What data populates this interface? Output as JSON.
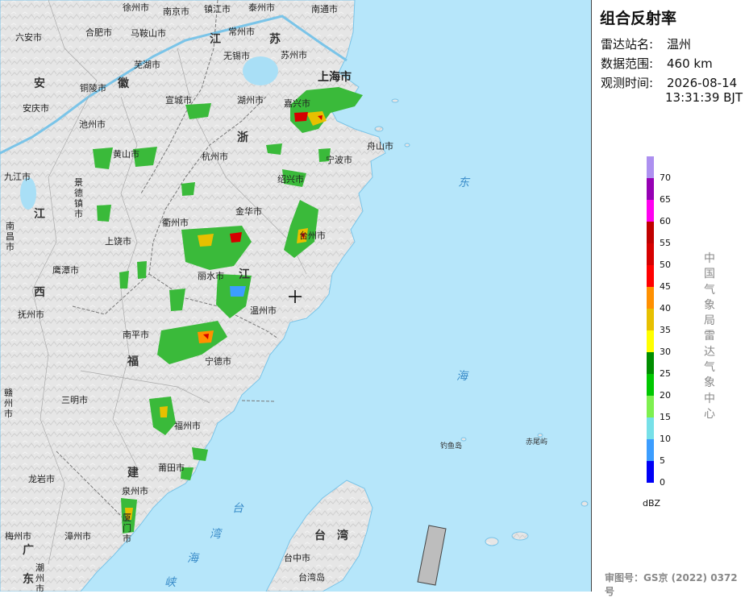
{
  "panel": {
    "title": "组合反射率",
    "station_label": "雷达站名:",
    "station_value": "温州",
    "range_label": "数据范围:",
    "range_value": "460 km",
    "time_label": "观测时间:",
    "time_date": "2026-08-14",
    "time_clock": "13:31:39 BJT",
    "org_vertical": "中国气象局雷达气象中心",
    "approval": "审图号：GS京 (2022) 0372号"
  },
  "legend": {
    "unit": "dBZ",
    "ticks": [
      "70",
      "65",
      "60",
      "55",
      "50",
      "45",
      "40",
      "35",
      "30",
      "25",
      "20",
      "15",
      "10",
      "5",
      "0"
    ],
    "colors": [
      "#ad90f0",
      "#9600b4",
      "#ff00f0",
      "#c00000",
      "#d60000",
      "#ff0000",
      "#ff9000",
      "#e7c000",
      "#ffff00",
      "#008e00",
      "#00c800",
      "#7ef050",
      "#77e0e8",
      "#3c9dff",
      "#0000f6"
    ]
  },
  "map": {
    "provinces": [
      "安",
      "徽",
      "江",
      "苏",
      "浙",
      "江",
      "江",
      "西",
      "福",
      "建",
      "广",
      "东",
      "台",
      "湾"
    ],
    "cities": [
      "徐州市",
      "南京市",
      "镇江市",
      "泰州市",
      "南通市",
      "六安市",
      "合肥市",
      "马鞍山市",
      "常州市",
      "芜湖市",
      "无锡市",
      "苏州市",
      "上海市",
      "安庆市",
      "铜陵市",
      "宣城市",
      "湖州市",
      "嘉兴市",
      "池州市",
      "黄山市",
      "杭州市",
      "舟山市",
      "宁波市",
      "九江市",
      "景德镇市",
      "绍兴市",
      "衢州市",
      "金华市",
      "台州市",
      "南昌市",
      "上饶市",
      "鹰潭市",
      "丽水市",
      "温州市",
      "抚州市",
      "南平市",
      "宁德市",
      "三明市",
      "福州市",
      "赣州市",
      "龙岩市",
      "莆田市",
      "泉州市",
      "漳州市",
      "梅州市",
      "厦门市",
      "潮州市",
      "台中市",
      "台湾岛"
    ],
    "seas": [
      "东",
      "海",
      "台",
      "湾",
      "海",
      "峡"
    ],
    "islands": [
      "钓鱼岛",
      "赤尾屿"
    ]
  }
}
